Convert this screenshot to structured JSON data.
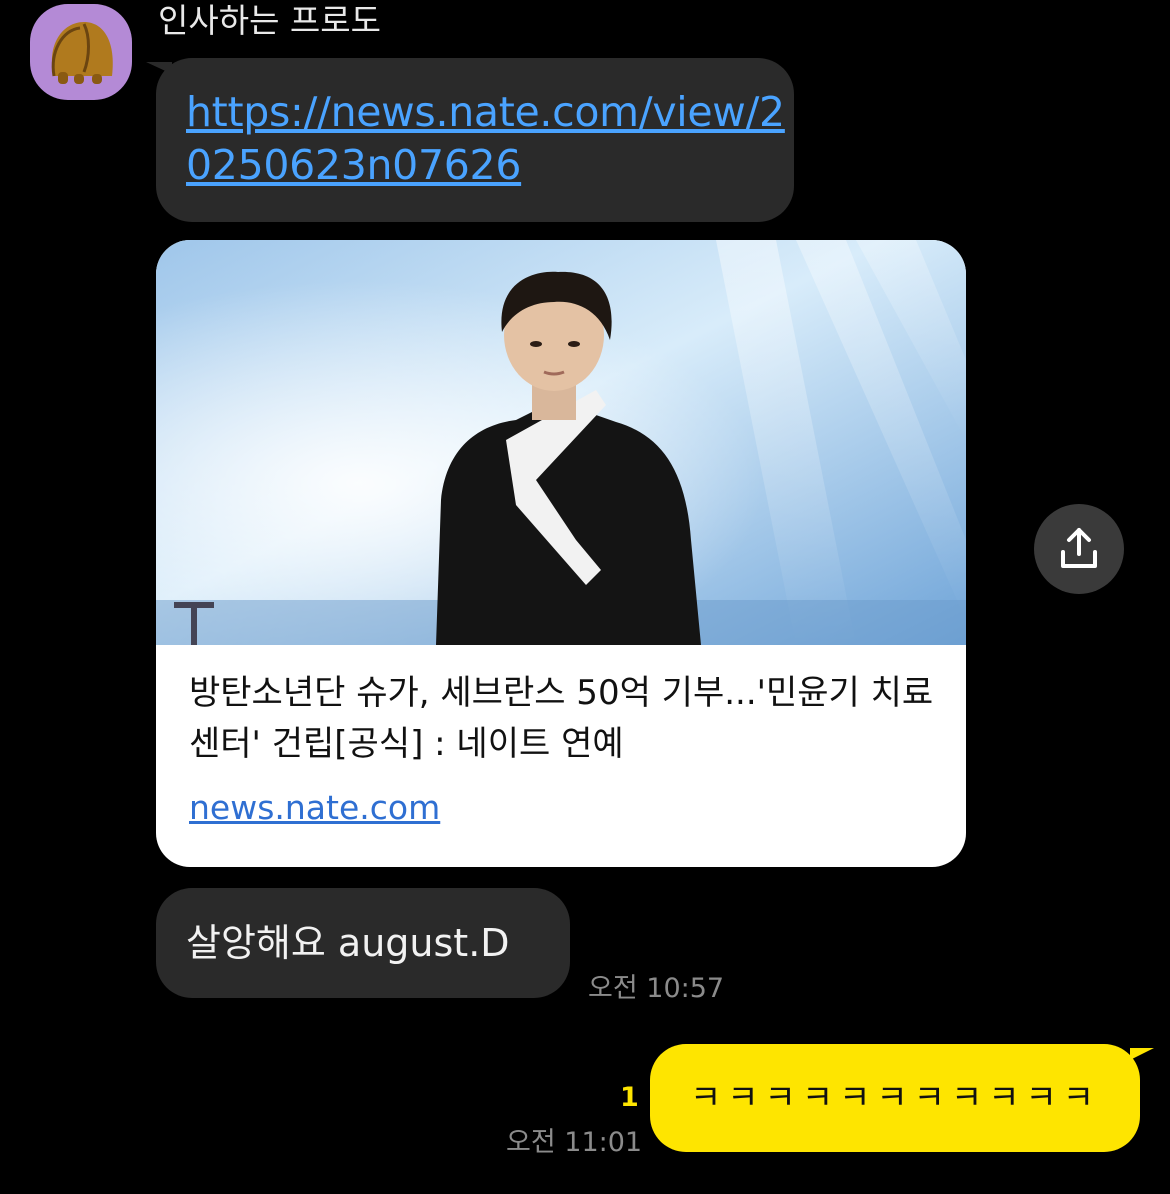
{
  "chat": {
    "sender_name": "인사하는 프로도",
    "avatar_icon": "frodo-character-icon",
    "link_message": "https://news.nate.com/view/20250623n07626",
    "link_preview": {
      "title": "방탄소년단 슈가, 세브란스 50억 기부...'민윤기 치료센터' 건립[공식] : 네이트 연예",
      "domain": "news.nate.com",
      "image_description": "performer-photo"
    },
    "share_icon": "share-icon",
    "incoming_text": "살앙해요 august.D",
    "incoming_time": "오전 10:57",
    "outgoing_text": "ㅋㅋㅋㅋㅋㅋㅋㅋㅋㅋㅋ",
    "outgoing_time": "오전 11:01",
    "unread_count": "1"
  },
  "colors": {
    "background": "#000000",
    "incoming_bubble": "#2a2a2a",
    "outgoing_bubble": "#fee500",
    "link": "#4aa3ff"
  }
}
